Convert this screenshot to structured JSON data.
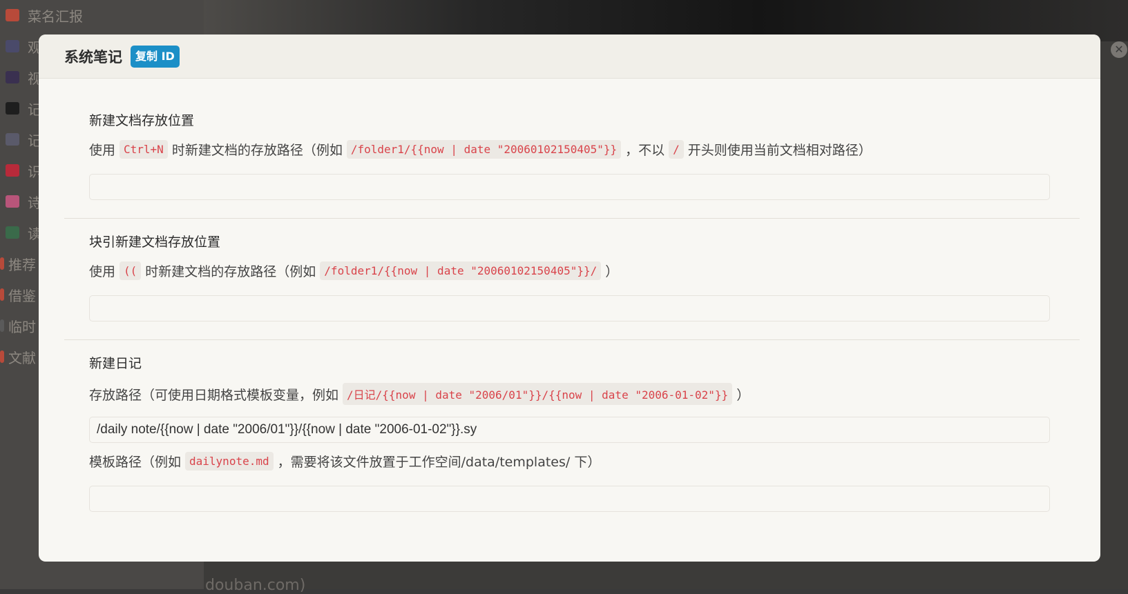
{
  "background": {
    "sidebar_items": [
      {
        "label": "菜名汇报",
        "icon": "bowl-icon",
        "color": "#b84a3a"
      },
      {
        "label": "观",
        "icon": "camera-icon",
        "color": "#4a4a6a"
      },
      {
        "label": "视",
        "icon": "clapper-icon",
        "color": "#3a3050"
      },
      {
        "label": "记",
        "icon": "triangle-icon",
        "color": "#1e1e1e"
      },
      {
        "label": "记",
        "icon": "notebook-icon",
        "color": "#5a5a6a"
      },
      {
        "label": "识",
        "icon": "note-icon",
        "color": "#b82a3a"
      },
      {
        "label": "诗",
        "icon": "brain-icon",
        "color": "#b8557a"
      },
      {
        "label": "读",
        "icon": "books-icon",
        "color": "#3a6a4a"
      },
      {
        "label": "推荐",
        "icon": "dot-icon",
        "color": "#b84a3a"
      },
      {
        "label": "借鉴",
        "icon": "dot-icon",
        "color": "#b84a3a"
      },
      {
        "label": "临时",
        "icon": "dot-icon",
        "color": "#5a5a5a"
      },
      {
        "label": "文献",
        "icon": "dot-icon",
        "color": "#b84a3a"
      }
    ],
    "footer_text": "douban.com)"
  },
  "dialog": {
    "title": "系统笔记",
    "copy_id_label": "复制 ID",
    "sections": {
      "new_doc": {
        "title": "新建文档存放位置",
        "desc_prefix": "使用",
        "desc_code1": "Ctrl+N",
        "desc_mid": "时新建文档的存放路径（例如",
        "desc_code2": "/folder1/{{now | date \"20060102150405\"}}",
        "desc_mid2": "，不以",
        "desc_code3": "/",
        "desc_suffix": "开头则使用当前文档相对路径）",
        "value": ""
      },
      "block_ref": {
        "title": "块引新建文档存放位置",
        "desc_prefix": "使用",
        "desc_code1": "((",
        "desc_mid": "时新建文档的存放路径（例如",
        "desc_code2": "/folder1/{{now | date \"20060102150405\"}}/",
        "desc_suffix": "）",
        "value": ""
      },
      "daily_note": {
        "title": "新建日记",
        "path_desc_prefix": "存放路径（可使用日期格式模板变量，例如",
        "path_desc_code": "/日记/{{now | date \"2006/01\"}}/{{now | date \"2006-01-02\"}}",
        "path_desc_suffix": "）",
        "path_value": "/daily note/{{now | date \"2006/01\"}}/{{now | date \"2006-01-02\"}}.sy",
        "template_desc_prefix": "模板路径（例如",
        "template_desc_code": "dailynote.md",
        "template_desc_suffix": "，需要将该文件放置于工作空间/data/templates/ 下）",
        "template_value": ""
      }
    }
  },
  "colors": {
    "accent": "#1c8fc7",
    "code_text": "#d9434a",
    "dialog_bg": "#f8f7f3"
  }
}
